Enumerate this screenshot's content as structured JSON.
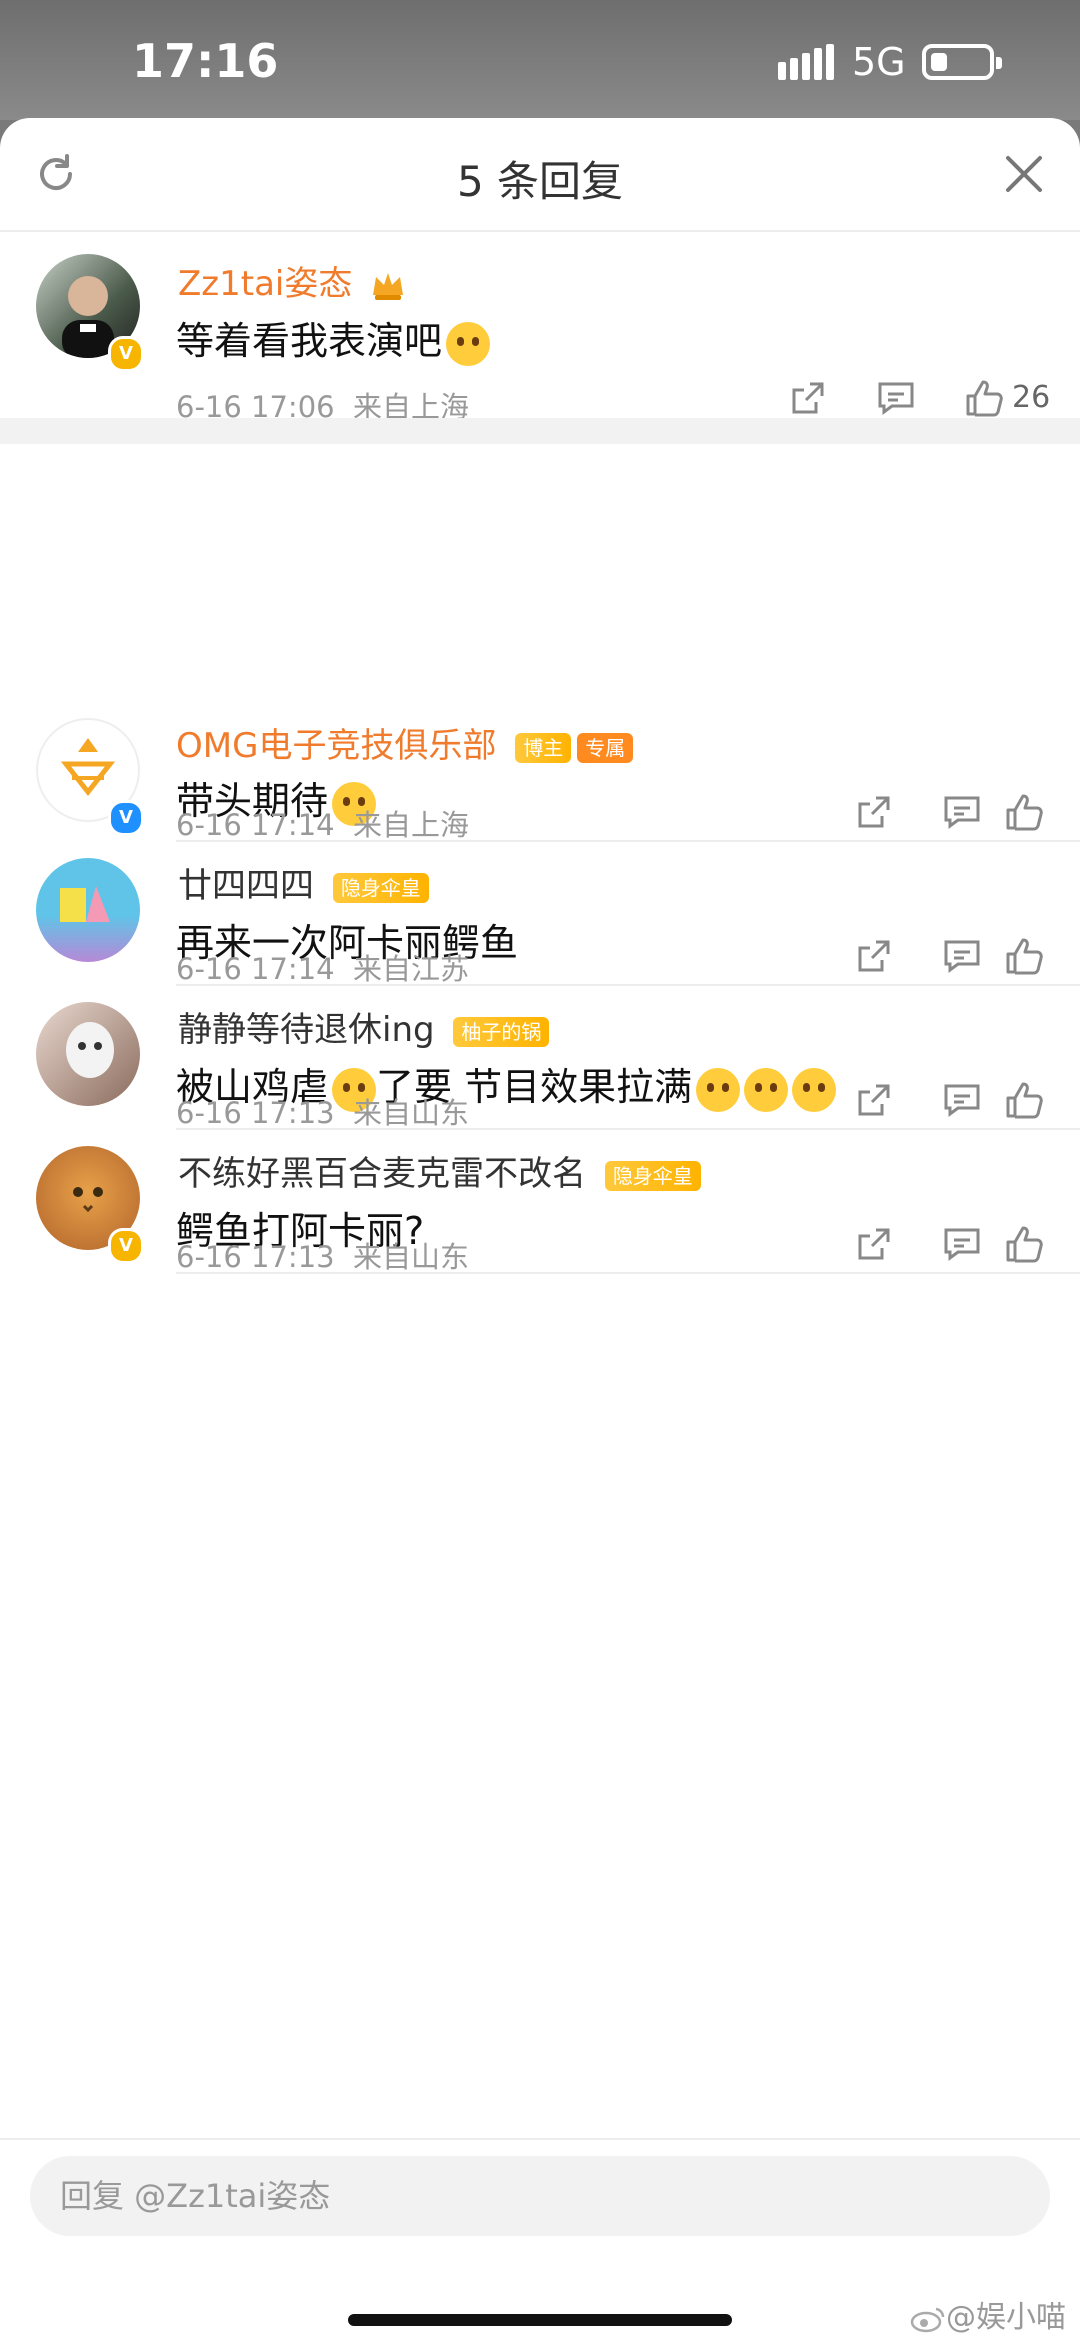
{
  "status": {
    "time": "17:16",
    "network": "5G"
  },
  "header": {
    "title": "5 条回复"
  },
  "main_comment": {
    "user": "Zz1tai姿态",
    "text": "等着看我表演吧",
    "time": "6-16 17:06",
    "location": "来自上海",
    "likes": "26"
  },
  "replies": [
    {
      "user": "OMG电子竞技俱乐部",
      "tags": [
        "博主",
        "专属"
      ],
      "text": "带头期待",
      "time": "6-16 17:14",
      "location": "来自上海"
    },
    {
      "user": "廿四四四",
      "tags": [
        "隐身伞皇"
      ],
      "text": "再来一次阿卡丽鳄鱼",
      "time": "6-16 17:14",
      "location": "来自江苏"
    },
    {
      "user": "静静等待退休ing",
      "tags": [
        "柚子的锅"
      ],
      "text_a": "被山鸡虐",
      "text_b": "了要 节目效果拉满",
      "time": "6-16 17:13",
      "location": "来自山东"
    },
    {
      "user": "不练好黑百合麦克雷不改名",
      "tags": [
        "隐身伞皇"
      ],
      "text": "鳄鱼打阿卡丽?",
      "time": "6-16 17:13",
      "location": "来自山东"
    }
  ],
  "footer": {
    "reply_placeholder": "回复 @Zz1tai姿态",
    "watermark": "@娱小喵"
  },
  "colors": {
    "accent": "#f07b2c",
    "gold": "#f7b500"
  },
  "icons": [
    "refresh-icon",
    "close-icon",
    "share-icon",
    "comment-icon",
    "like-icon",
    "verified-badge",
    "crown-icon",
    "emoji-icon",
    "weibo-icon"
  ]
}
